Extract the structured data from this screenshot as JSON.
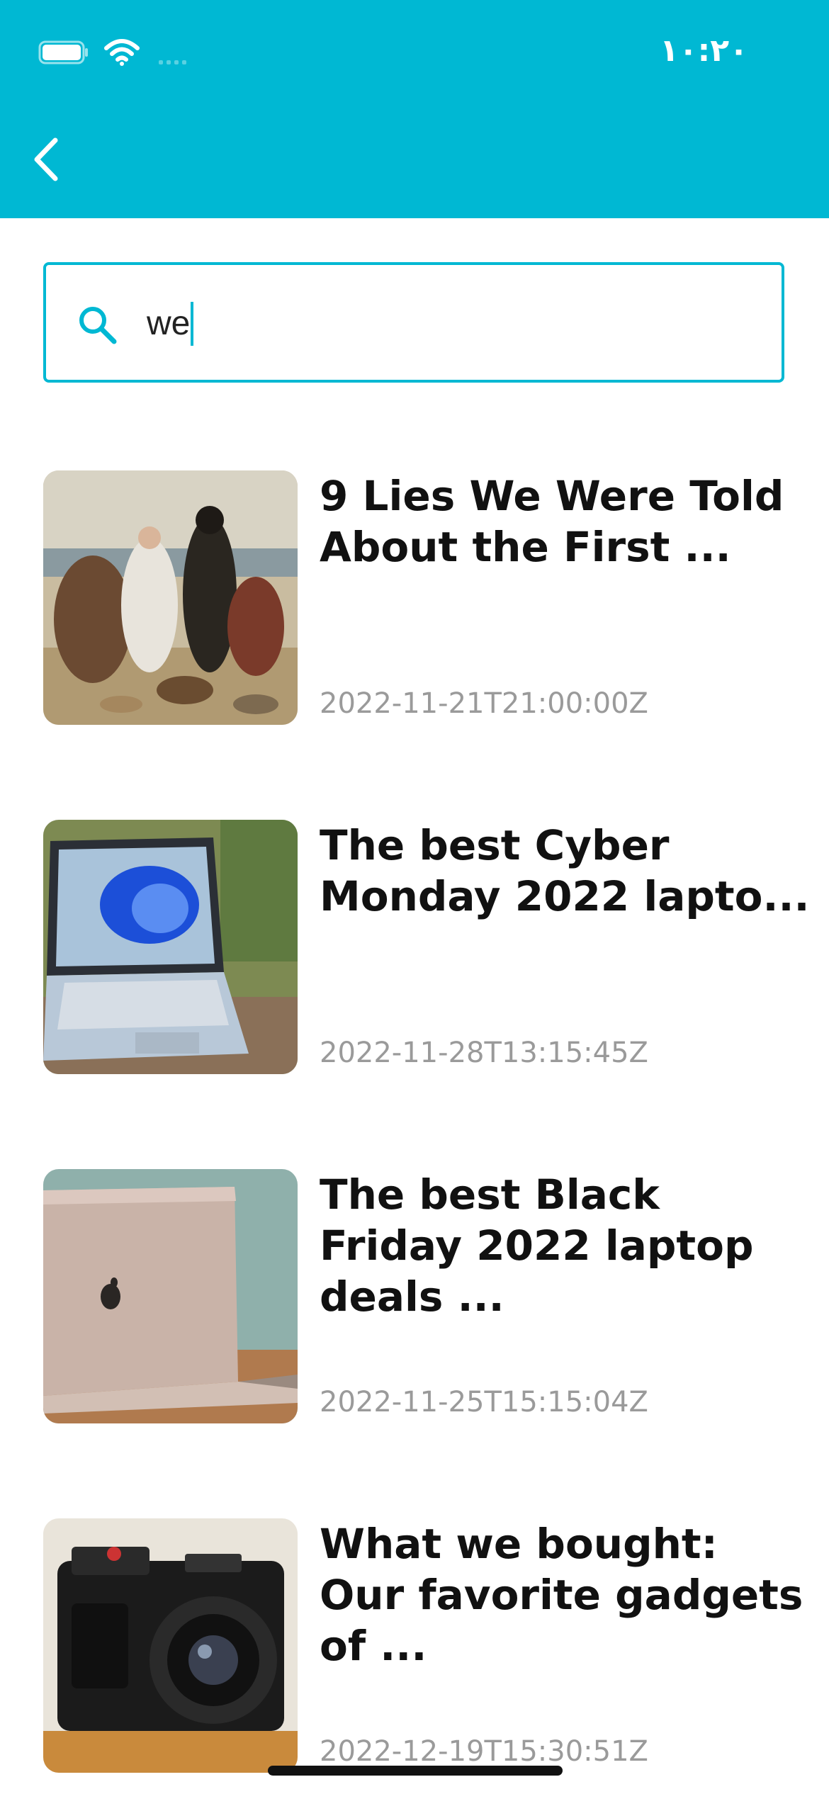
{
  "status_bar": {
    "time": "١٠:٢٠"
  },
  "header": {
    "accent_color": "#00b8d3",
    "back_icon": "chevron-left-icon"
  },
  "search": {
    "value": "we",
    "icon": "search-icon"
  },
  "articles": [
    {
      "title": "9 Lies We Were Told About the First ...",
      "date": "2022-11-21T21:00:00Z",
      "image": "painting-first-thanksgiving"
    },
    {
      "title": "The best Cyber Monday 2022 lapto...",
      "date": "2022-11-28T13:15:45Z",
      "image": "laptop-windows-11"
    },
    {
      "title": "The best Black Friday 2022 laptop deals ...",
      "date": "2022-11-25T15:15:04Z",
      "image": "laptop-macbook"
    },
    {
      "title": "What we bought: Our favorite gadgets of ...",
      "date": "2022-12-19T15:30:51Z",
      "image": "camera-fujifilm"
    }
  ]
}
